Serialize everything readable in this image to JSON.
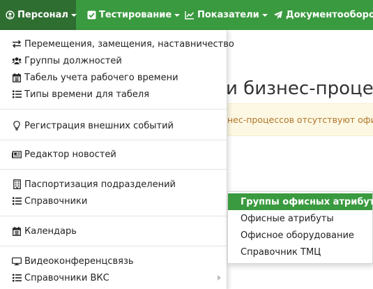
{
  "navbar": {
    "items": [
      {
        "label": "Персонал",
        "icon": "user-circle-icon",
        "active": true
      },
      {
        "label": "Тестирование",
        "icon": "check-square-icon",
        "active": false
      },
      {
        "label": "Показатели",
        "icon": "line-chart-icon",
        "active": false
      },
      {
        "label": "Документооборот",
        "icon": "paper-plane-icon",
        "active": false
      }
    ]
  },
  "page": {
    "title": "и бизнес-процес",
    "alert_text": "нес-процессов отсутствуют офисн"
  },
  "dropdown": {
    "items": [
      {
        "label": "Перемещения, замещения, наставничество",
        "icon": "exchange-icon"
      },
      {
        "label": "Группы должностей",
        "icon": "users-icon"
      },
      {
        "label": "Табель учета рабочего времени",
        "icon": "calendar-icon"
      },
      {
        "label": "Типы времени для табеля",
        "icon": "list-icon"
      },
      {
        "label": "Регистрация внешних событий",
        "icon": "lightbulb-icon"
      },
      {
        "label": "Редактор новостей",
        "icon": "newspaper-icon"
      },
      {
        "label": "Паспортизация подразделений",
        "icon": "building-icon"
      },
      {
        "label": "Справочники",
        "icon": "list-icon"
      },
      {
        "label": "Календарь",
        "icon": "calendar-icon"
      },
      {
        "label": "Видеоконференцсвязь",
        "icon": "monitor-icon"
      },
      {
        "label": "Справочники ВКС",
        "icon": "list-icon"
      }
    ]
  },
  "submenu": {
    "items": [
      {
        "label": "Группы офисных атрибутов",
        "active": true
      },
      {
        "label": "Офисные атрибуты",
        "active": false
      },
      {
        "label": "Офисное оборудование",
        "active": false
      },
      {
        "label": "Справочник ТМЦ",
        "active": false
      }
    ]
  },
  "colors": {
    "navbar": "#3a9a3f",
    "navbar_active": "#2f6e31",
    "submenu_active": "#3a9a3f",
    "alert_bg": "#fcf8e3",
    "alert_text": "#b0752a"
  }
}
